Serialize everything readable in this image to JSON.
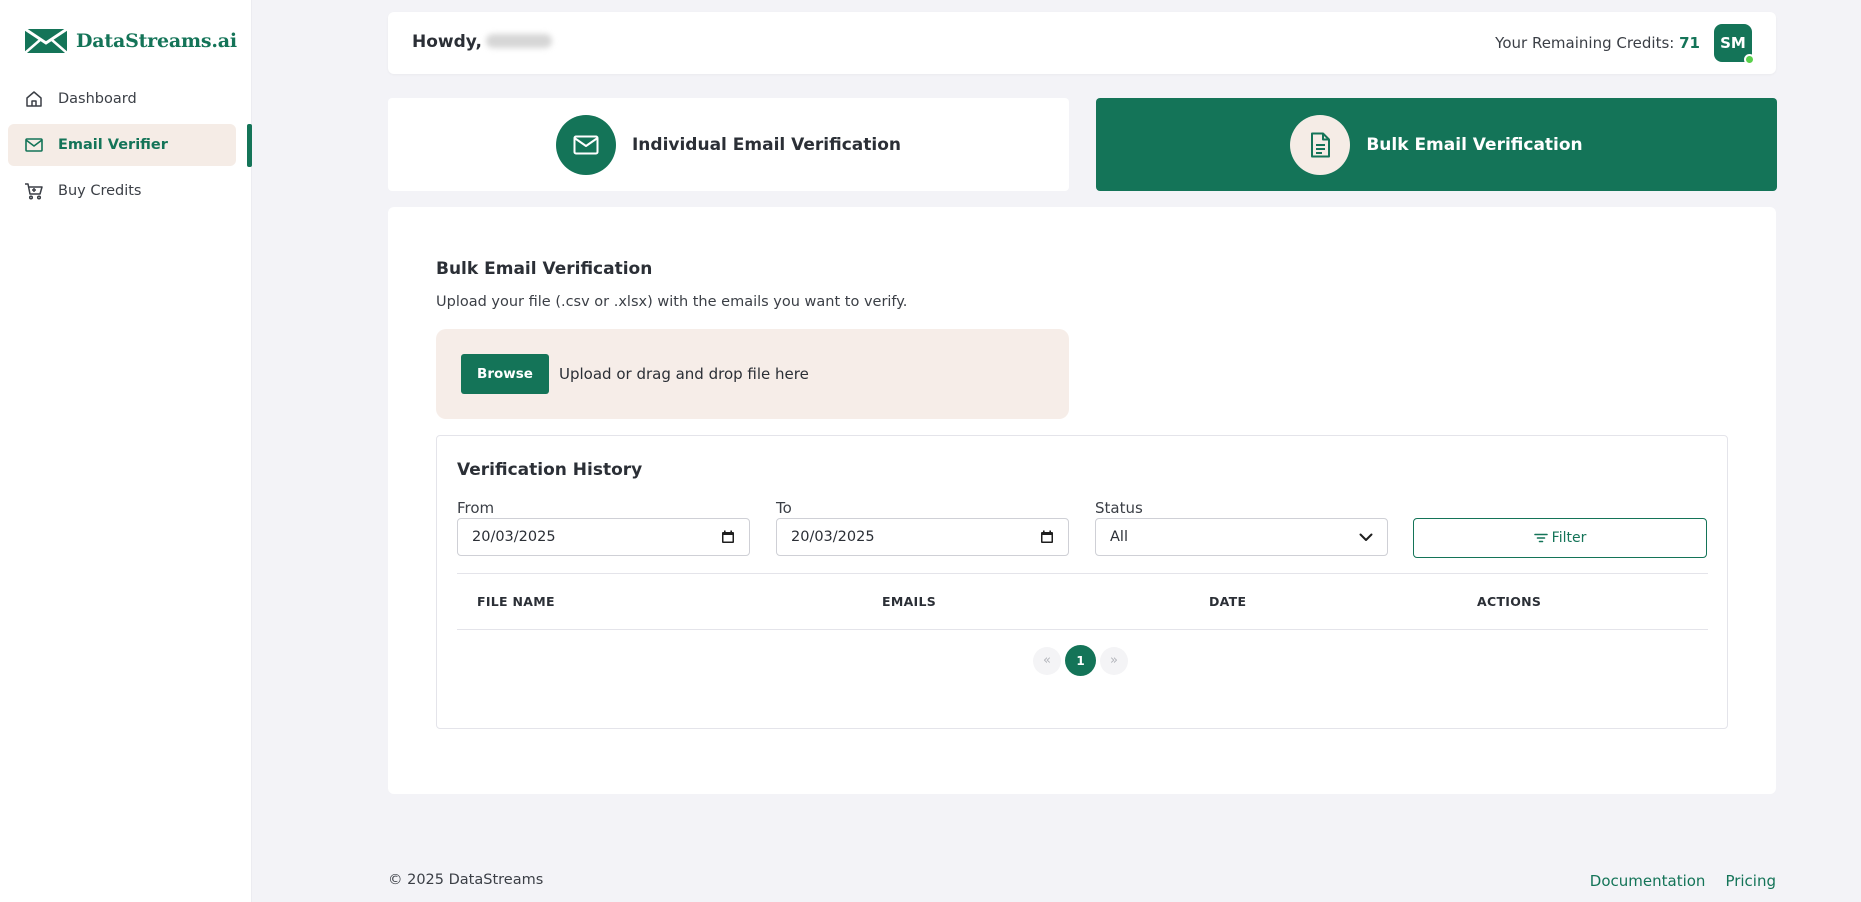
{
  "brand": {
    "name": "DataStreams.ai",
    "accent": "#147458"
  },
  "sidebar": {
    "items": [
      {
        "label": "Dashboard",
        "icon": "home-icon",
        "active": false
      },
      {
        "label": "Email Verifier",
        "icon": "mail-icon",
        "active": true
      },
      {
        "label": "Buy Credits",
        "icon": "cart-icon",
        "active": false
      }
    ]
  },
  "header": {
    "greeting": "Howdy,",
    "credits_label": "Your Remaining Credits:",
    "credits_value": "71",
    "avatar_initials": "SM"
  },
  "tabs": [
    {
      "label": "Individual Email Verification",
      "icon": "mail-icon",
      "selected": false
    },
    {
      "label": "Bulk Email Verification",
      "icon": "document-icon",
      "selected": true
    }
  ],
  "bulk": {
    "title": "Bulk Email Verification",
    "subtitle": "Upload your file (.csv or .xlsx) with the emails you want to verify.",
    "browse_label": "Browse",
    "upload_text": "Upload or drag and drop file here"
  },
  "history": {
    "title": "Verification History",
    "from_label": "From",
    "from_value": "20/03/2025",
    "to_label": "To",
    "to_value": "20/03/2025",
    "status_label": "Status",
    "status_value": "All",
    "filter_label": "Filter",
    "columns": [
      "FILE NAME",
      "EMAILS",
      "DATE",
      "ACTIONS"
    ],
    "pagination": {
      "prev": "«",
      "current": "1",
      "next": "»"
    }
  },
  "footer": {
    "copyright": "© 2025 DataStreams",
    "links": [
      "Documentation",
      "Pricing"
    ]
  }
}
